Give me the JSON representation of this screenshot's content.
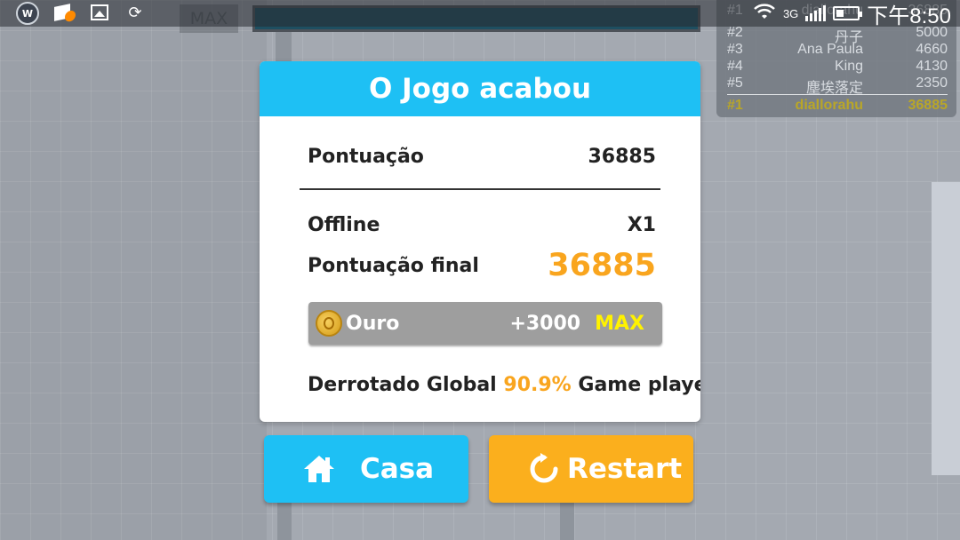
{
  "status_bar": {
    "network": "3G",
    "time": "下午8:50",
    "app_icons": [
      "game-app-icon",
      "cube-notify-icon",
      "gallery-icon",
      "sync-icon"
    ],
    "app_icon_letter": "W"
  },
  "hud": {
    "max_label": "MAX",
    "progress": 1.0
  },
  "leaderboard": {
    "entries": [
      {
        "rank": "#1",
        "name": "diallorahu",
        "score": "36885"
      },
      {
        "rank": "#2",
        "name": "丹子",
        "score": "5000"
      },
      {
        "rank": "#3",
        "name": "Ana Paula",
        "score": "4660"
      },
      {
        "rank": "#4",
        "name": "King",
        "score": "4130"
      },
      {
        "rank": "#5",
        "name": "塵埃落定",
        "score": "2350"
      }
    ],
    "me": {
      "rank": "#1",
      "name": "diallorahu",
      "score": "36885"
    }
  },
  "dialog": {
    "title": "O Jogo acabou",
    "score_label": "Pontuação",
    "score_value": "36885",
    "mode_label": "Offline",
    "multiplier": "X1",
    "final_label": "Pontuação final",
    "final_value": "36885",
    "gold_label": "Ouro",
    "gold_amount": "+3000",
    "gold_max": "MAX",
    "defeat_prefix": "Derrotado Global",
    "defeat_percent": "90.9%",
    "defeat_suffix": "Game players"
  },
  "buttons": {
    "home_label": "Casa",
    "restart_label": "Restart"
  },
  "colors": {
    "accent_blue": "#1ec0f4",
    "accent_orange": "#fbaf1d",
    "highlight_orange": "#f9a51e",
    "gold_max_yellow": "#fff200"
  }
}
